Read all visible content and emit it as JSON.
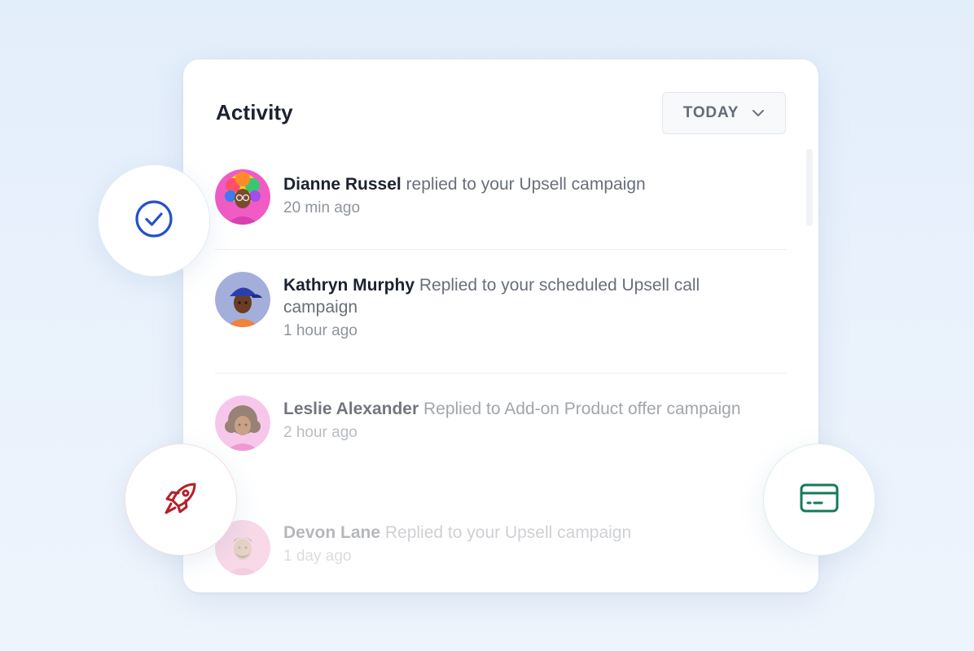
{
  "activity": {
    "title": "Activity",
    "filter": {
      "label": "TODAY",
      "icon": "chevron-down-icon"
    },
    "items": [
      {
        "name": "Dianne Russel",
        "action": " replied to your Upsell campaign",
        "time": "20 min ago",
        "avatar": "avatar-rainbow-hair"
      },
      {
        "name": "Kathryn Murphy",
        "action": " Replied to your scheduled Upsell call campaign",
        "time": "1 hour ago",
        "avatar": "avatar-blue-cap"
      },
      {
        "name": "Leslie Alexander",
        "action": " Replied to Add-on Product offer campaign",
        "time": "2 hour ago",
        "avatar": "avatar-curly-hair"
      },
      {
        "name": "Devon Lane",
        "action": " Replied to your Upsell campaign",
        "time": "1 day ago",
        "avatar": "avatar-beard"
      }
    ]
  },
  "badges": [
    {
      "icon": "check-circle-icon",
      "color": "#2451c9"
    },
    {
      "icon": "rocket-icon",
      "color": "#b3202b"
    },
    {
      "icon": "credit-card-icon",
      "color": "#147a57"
    }
  ]
}
